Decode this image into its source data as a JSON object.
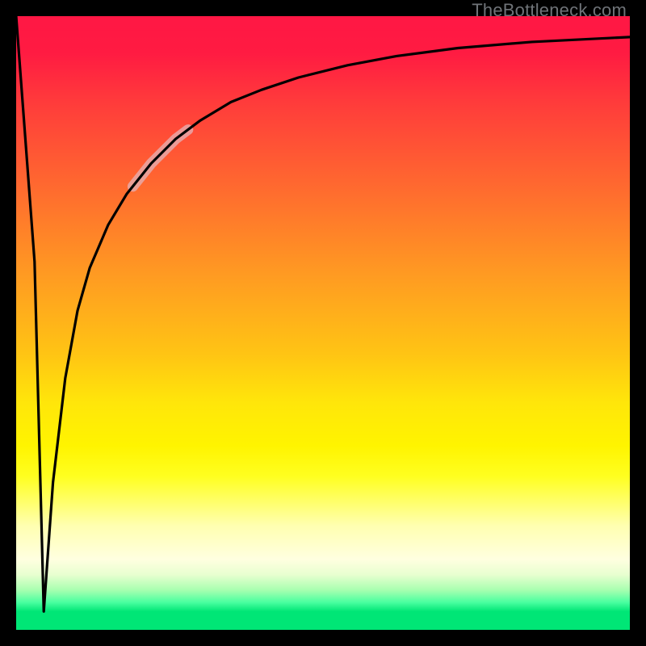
{
  "watermark": "TheBottleneck.com",
  "chart_data": {
    "type": "line",
    "title": "",
    "xlabel": "",
    "ylabel": "",
    "xlim": [
      0,
      100
    ],
    "ylim": [
      0,
      100
    ],
    "grid": false,
    "legend": false,
    "series": [
      {
        "name": "bottleneck-curve",
        "x": [
          0,
          3,
          4.5,
          6,
          8,
          10,
          12,
          15,
          18,
          22,
          26,
          30,
          35,
          40,
          46,
          54,
          62,
          72,
          84,
          100
        ],
        "y": [
          100,
          60,
          3,
          24,
          41,
          52,
          59,
          66,
          71,
          76,
          80,
          83,
          86,
          88,
          90,
          92,
          93.5,
          94.8,
          95.8,
          96.6
        ]
      }
    ],
    "highlight": {
      "name": "resolution-band",
      "x_range": [
        19,
        28
      ],
      "y_range": [
        73,
        81
      ]
    },
    "colors": {
      "curve": "#000000",
      "highlight": "#e5b0b4",
      "gradient_top": "#ff1744",
      "gradient_mid": "#ffe60a",
      "gradient_bottom": "#00e676",
      "frame": "#000000"
    }
  }
}
